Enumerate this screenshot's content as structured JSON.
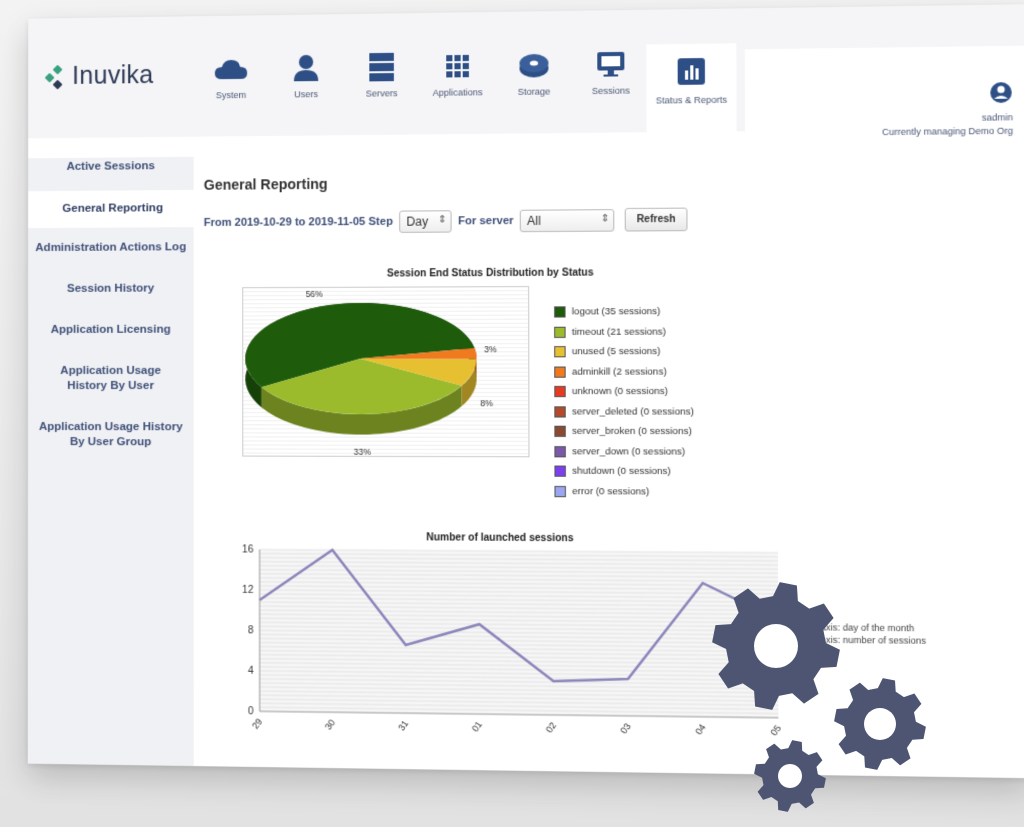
{
  "app": {
    "brand": "Inuvika"
  },
  "nav": [
    {
      "label": "System",
      "icon": "cloud-icon"
    },
    {
      "label": "Users",
      "icon": "user-icon"
    },
    {
      "label": "Servers",
      "icon": "server-icon"
    },
    {
      "label": "Applications",
      "icon": "grid-icon"
    },
    {
      "label": "Storage",
      "icon": "storage-icon"
    },
    {
      "label": "Sessions",
      "icon": "monitor-icon"
    },
    {
      "label": "Status & Reports",
      "icon": "bar-chart-icon",
      "active": true
    }
  ],
  "user": {
    "name": "sadmin",
    "org": "Currently managing Demo Org"
  },
  "sidebar": [
    {
      "label": "Active Sessions"
    },
    {
      "label": "General Reporting",
      "active": true
    },
    {
      "label": "Administration Actions Log"
    },
    {
      "label": "Session History"
    },
    {
      "label": "Application Licensing"
    },
    {
      "label": "Application Usage History By User"
    },
    {
      "label": "Application Usage History By User Group"
    }
  ],
  "page": {
    "title": "General Reporting",
    "filter_prefix": "From 2019-10-29 to 2019-11-05 Step",
    "step_value": "Day",
    "server_label": "For server",
    "server_value": "All",
    "refresh_label": "Refresh"
  },
  "colors": {
    "accent": "#3e4f78",
    "logo_green": "#3aa17e",
    "gear": "#4d5572"
  },
  "chart_data": [
    {
      "type": "pie",
      "title": "Session End Status Distribution by Status",
      "slices": [
        {
          "label": "logout (35 sessions)",
          "value": 35,
          "pct_label": "56%",
          "color": "#1e5c0b"
        },
        {
          "label": "timeout (21 sessions)",
          "value": 21,
          "pct_label": "33%",
          "color": "#9bbb2d"
        },
        {
          "label": "unused (5 sessions)",
          "value": 5,
          "pct_label": "8%",
          "color": "#e6c030"
        },
        {
          "label": "adminkill (2 sessions)",
          "value": 2,
          "pct_label": "3%",
          "color": "#ef7a1f"
        },
        {
          "label": "unknown (0 sessions)",
          "value": 0,
          "color": "#e63b1f"
        },
        {
          "label": "server_deleted (0 sessions)",
          "value": 0,
          "color": "#b24a2c"
        },
        {
          "label": "server_broken (0 sessions)",
          "value": 0,
          "color": "#8a4a32"
        },
        {
          "label": "server_down (0 sessions)",
          "value": 0,
          "color": "#7a5aa8"
        },
        {
          "label": "shutdown (0 sessions)",
          "value": 0,
          "color": "#7b3ff0"
        },
        {
          "label": "error (0 sessions)",
          "value": 0,
          "color": "#9aa6f0"
        }
      ]
    },
    {
      "type": "line",
      "title": "Number of launched sessions",
      "x": [
        "29",
        "30",
        "31",
        "01",
        "02",
        "03",
        "04",
        "05"
      ],
      "values": [
        11,
        16,
        6.7,
        8.8,
        3.3,
        3.6,
        13,
        9.5
      ],
      "ylim": [
        0,
        16
      ],
      "yticks": [
        0,
        4,
        8,
        12,
        16
      ],
      "color": "#8b86bb",
      "grid": true,
      "legend_lines": [
        "x axis: day of the month",
        "y axis: number of sessions"
      ]
    }
  ]
}
